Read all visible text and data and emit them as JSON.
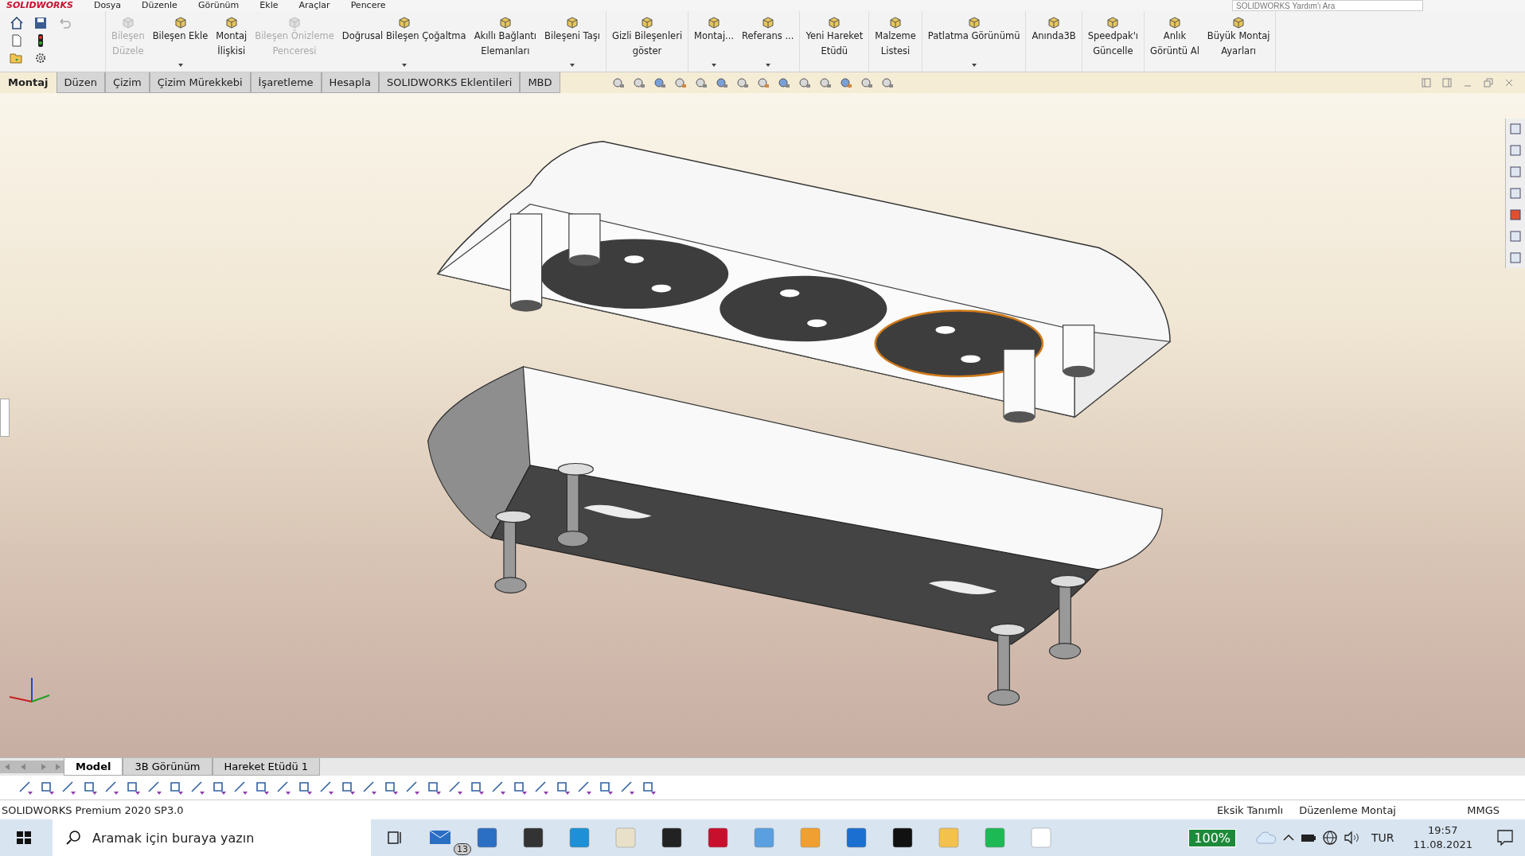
{
  "menu_bar": {
    "logo": "SOLIDWORKS",
    "items": [
      "Dosya",
      "Düzenle",
      "Görünüm",
      "Ekle",
      "Araçlar",
      "Pencere"
    ],
    "search": {
      "placeholder": "SOLIDWORKS Yardım'ı Ara"
    }
  },
  "ribbon": {
    "groups": [
      {
        "buttons": [
          {
            "lines": [
              "Bileşen",
              "Düzele"
            ],
            "disabled": true,
            "dropdown": false
          },
          {
            "lines": [
              "Bileşen Ekle"
            ],
            "disabled": false,
            "dropdown": true
          },
          {
            "lines": [
              "Montaj",
              "İlişkisi"
            ],
            "disabled": false,
            "dropdown": false
          },
          {
            "lines": [
              "Bileşen Önizleme",
              "Penceresi"
            ],
            "disabled": true,
            "dropdown": false
          },
          {
            "lines": [
              "Doğrusal Bileşen Çoğaltma"
            ],
            "disabled": false,
            "dropdown": true
          },
          {
            "lines": [
              "Akıllı Bağlantı",
              "Elemanları"
            ],
            "disabled": false,
            "dropdown": false
          },
          {
            "lines": [
              "Bileşeni Taşı"
            ],
            "disabled": false,
            "dropdown": true
          }
        ]
      },
      {
        "buttons": [
          {
            "lines": [
              "Gizli Bileşenleri",
              "göster"
            ],
            "disabled": false,
            "dropdown": false
          }
        ]
      },
      {
        "buttons": [
          {
            "lines": [
              "Montaj..."
            ],
            "disabled": false,
            "dropdown": true
          },
          {
            "lines": [
              "Referans ..."
            ],
            "disabled": false,
            "dropdown": true
          }
        ]
      },
      {
        "buttons": [
          {
            "lines": [
              "Yeni Hareket",
              "Etüdü"
            ],
            "disabled": false,
            "dropdown": false
          }
        ]
      },
      {
        "buttons": [
          {
            "lines": [
              "Malzeme",
              "Listesi"
            ],
            "disabled": false,
            "dropdown": false
          }
        ]
      },
      {
        "buttons": [
          {
            "lines": [
              "Patlatma Görünümü"
            ],
            "disabled": false,
            "dropdown": true
          }
        ]
      },
      {
        "buttons": [
          {
            "lines": [
              "Anında3B"
            ],
            "disabled": false,
            "dropdown": false
          }
        ]
      },
      {
        "buttons": [
          {
            "lines": [
              "Speedpak'ı",
              "Güncelle"
            ],
            "disabled": false,
            "dropdown": false
          }
        ]
      },
      {
        "buttons": [
          {
            "lines": [
              "Anlık",
              "Görüntü Al"
            ],
            "disabled": false,
            "dropdown": false
          },
          {
            "lines": [
              "Büyük Montaj",
              "Ayarları"
            ],
            "disabled": false,
            "dropdown": false
          }
        ]
      }
    ]
  },
  "command_tabs": [
    {
      "label": "Montaj",
      "selected": true
    },
    {
      "label": "Düzen",
      "selected": false
    },
    {
      "label": "Çizim",
      "selected": false
    },
    {
      "label": "Çizim Mürekkebi",
      "selected": false
    },
    {
      "label": "İşaretleme",
      "selected": false
    },
    {
      "label": "Hesapla",
      "selected": false
    },
    {
      "label": "SOLIDWORKS Eklentileri",
      "selected": false
    },
    {
      "label": "MBD",
      "selected": false
    }
  ],
  "model_tabs": [
    {
      "label": "Model",
      "selected": true
    },
    {
      "label": "3B Görünüm",
      "selected": false
    },
    {
      "label": "Hareket Etüdü 1",
      "selected": false
    }
  ],
  "status_bar": {
    "product": "SOLIDWORKS Premium 2020 SP3.0",
    "state": "Eksik Tanımlı",
    "mode": "Düzenleme Montaj",
    "units": "MMGS"
  },
  "taskbar": {
    "search": {
      "placeholder": "Aramak için buraya yazın"
    },
    "mail_badge": "13",
    "battery_label": "100%",
    "language": "TUR",
    "time": "19:57",
    "date": "11.08.2021"
  }
}
